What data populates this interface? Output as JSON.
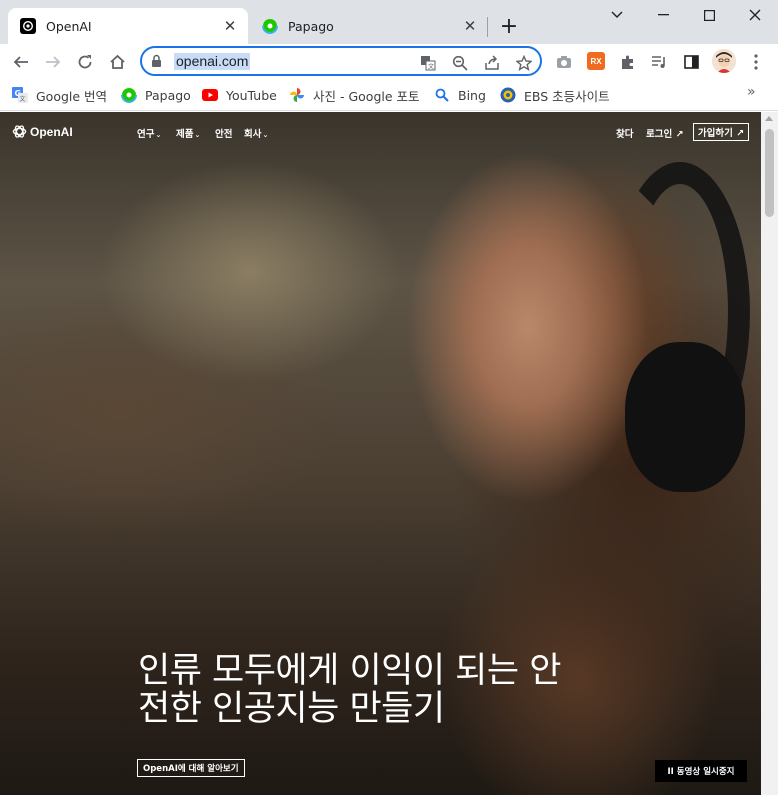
{
  "browser": {
    "tabs": [
      {
        "title": "OpenAI",
        "icon": "openai-favicon",
        "active": true
      },
      {
        "title": "Papago",
        "icon": "papago-favicon",
        "active": false
      }
    ],
    "address_bar": {
      "url": "openai.com"
    },
    "bookmarks": [
      {
        "label": "Google 번역",
        "icon": "google-translate-icon"
      },
      {
        "label": "Papago",
        "icon": "papago-icon"
      },
      {
        "label": "YouTube",
        "icon": "youtube-icon"
      },
      {
        "label": "사진 - Google 포토",
        "icon": "google-photos-icon"
      },
      {
        "label": "Bing",
        "icon": "search-icon"
      },
      {
        "label": "EBS 초등사이트",
        "icon": "ebs-icon"
      }
    ],
    "extension_badge": "RX"
  },
  "site": {
    "logo_text": "OpenAI",
    "nav": [
      {
        "label": "연구",
        "dropdown": true
      },
      {
        "label": "제품",
        "dropdown": true
      },
      {
        "label": "안전",
        "dropdown": false
      },
      {
        "label": "회사",
        "dropdown": true
      }
    ],
    "search_label": "찾다",
    "login_label": "로그인 ↗",
    "signup_label": "가입하기 ↗",
    "hero_line1": "인류 모두에게 이익이 되는 안",
    "hero_line2": "전한 인공지능 만들기",
    "about_label": "OpenAI에 대해 알아보기",
    "pause_label": "II  동영상 일시중지"
  },
  "colors": {
    "accent": "#1a73e8",
    "tabstrip_bg": "#dee1e6",
    "youtube_red": "#ff0000",
    "rx_orange": "#f06b1e"
  }
}
